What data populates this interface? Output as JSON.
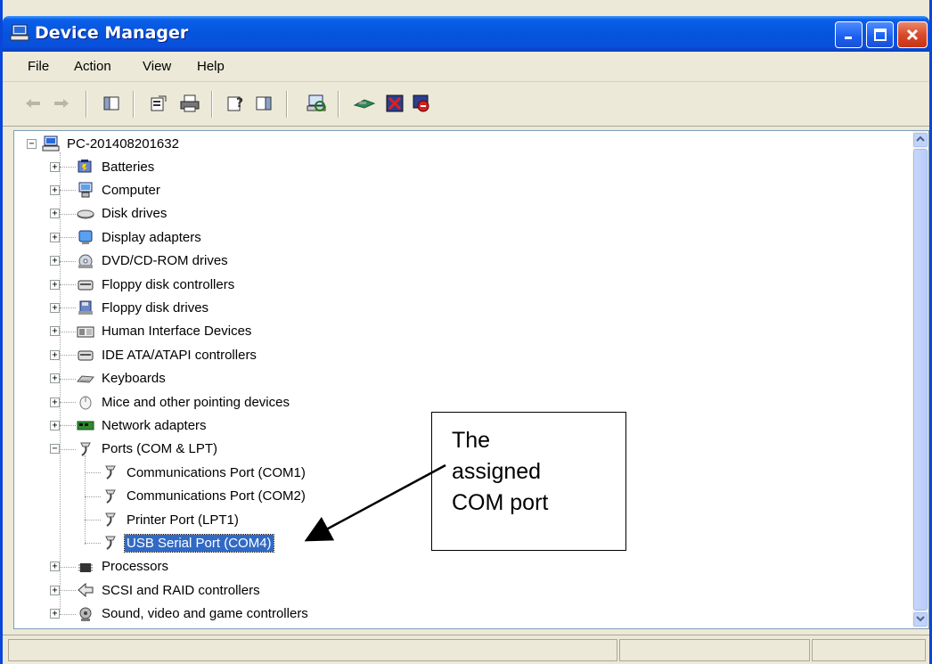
{
  "window": {
    "title": "Device Manager",
    "controls": [
      "minimize",
      "maximize",
      "close"
    ]
  },
  "menu": [
    "File",
    "Action",
    "View",
    "Help"
  ],
  "toolbar": {
    "buttons": [
      "back-icon",
      "forward-icon",
      "show-hide-console-tree-icon",
      "properties-icon",
      "print-icon",
      "help-icon",
      "show-hide-action-pane-icon",
      "scan-hardware-icon",
      "update-driver-icon",
      "disable-device-icon",
      "uninstall-device-icon"
    ]
  },
  "tree": {
    "root": "PC-201408201632",
    "categories": [
      {
        "label": "Batteries",
        "icon": "battery-icon",
        "expanded": false
      },
      {
        "label": "Computer",
        "icon": "computer-icon",
        "expanded": false
      },
      {
        "label": "Disk drives",
        "icon": "disk-drive-icon",
        "expanded": false
      },
      {
        "label": "Display adapters",
        "icon": "display-adapter-icon",
        "expanded": false
      },
      {
        "label": "DVD/CD-ROM drives",
        "icon": "cdrom-icon",
        "expanded": false
      },
      {
        "label": "Floppy disk controllers",
        "icon": "controller-icon",
        "expanded": false
      },
      {
        "label": "Floppy disk drives",
        "icon": "floppy-icon",
        "expanded": false
      },
      {
        "label": "Human Interface Devices",
        "icon": "hid-icon",
        "expanded": false
      },
      {
        "label": "IDE ATA/ATAPI controllers",
        "icon": "controller-icon",
        "expanded": false
      },
      {
        "label": "Keyboards",
        "icon": "keyboard-icon",
        "expanded": false
      },
      {
        "label": "Mice and other pointing devices",
        "icon": "mouse-icon",
        "expanded": false
      },
      {
        "label": "Network adapters",
        "icon": "network-adapter-icon",
        "expanded": false
      },
      {
        "label": "Ports (COM & LPT)",
        "icon": "port-icon",
        "expanded": true
      },
      {
        "label": "Processors",
        "icon": "processor-icon",
        "expanded": false
      },
      {
        "label": "SCSI and RAID controllers",
        "icon": "scsi-icon",
        "expanded": false
      },
      {
        "label": "Sound, video and game controllers",
        "icon": "sound-icon",
        "expanded": false
      }
    ],
    "ports_children": [
      {
        "label": "Communications Port (COM1)",
        "selected": false
      },
      {
        "label": "Communications Port (COM2)",
        "selected": false
      },
      {
        "label": "Printer Port (LPT1)",
        "selected": false
      },
      {
        "label": "USB Serial Port (COM4)",
        "selected": true
      }
    ]
  },
  "callout": {
    "text": "The\nassigned\nCOM port"
  },
  "colors": {
    "titlebar": "#0654dd",
    "selection": "#316ac5",
    "window_face": "#ece9d8"
  }
}
